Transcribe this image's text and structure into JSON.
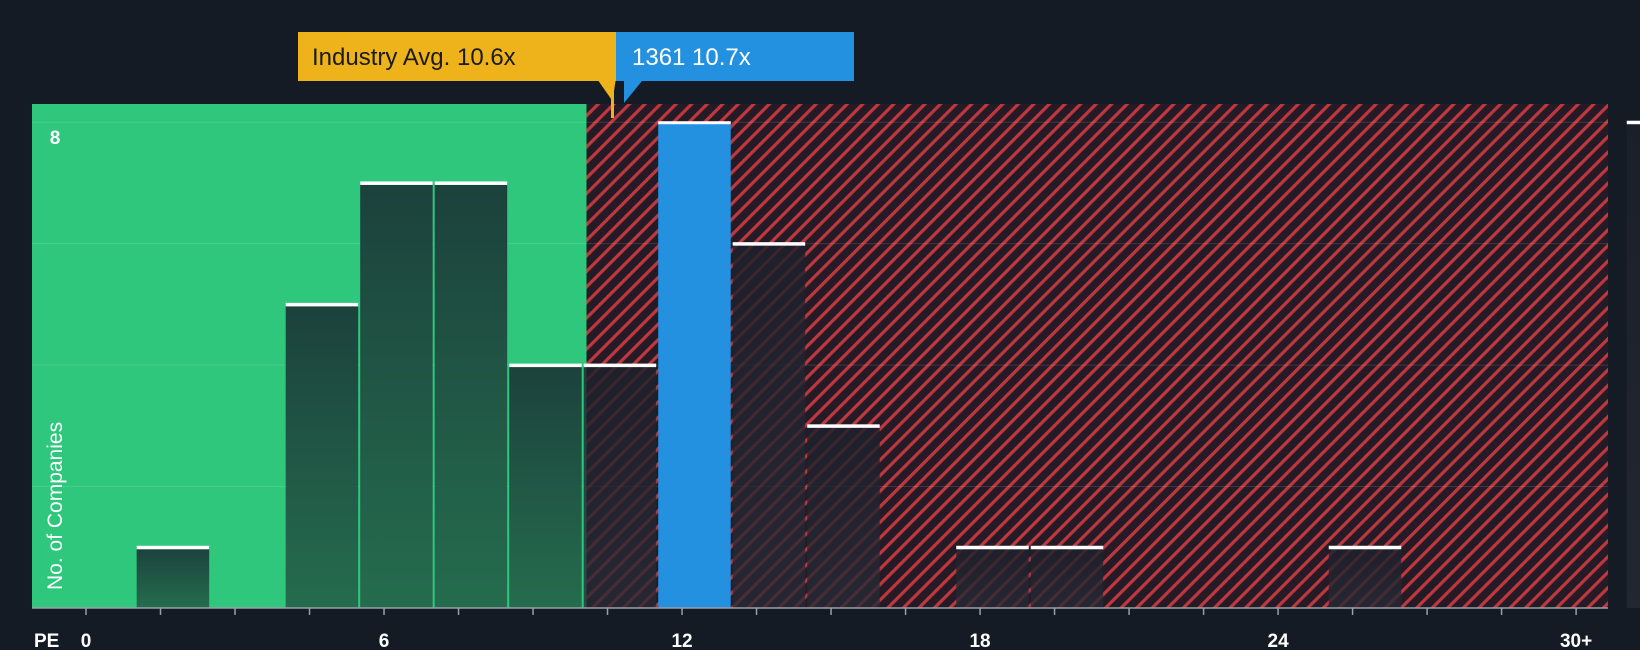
{
  "chart_data": {
    "type": "bar",
    "title": "",
    "xlabel": "PE",
    "ylabel": "No. of Companies",
    "x_ticks": [
      "0",
      "6",
      "12",
      "18",
      "24",
      "30+"
    ],
    "y_ticks": [
      "8"
    ],
    "ylim": [
      0,
      8.3
    ],
    "bins": [
      {
        "from": 1.0,
        "to": 2.5,
        "value": 1
      },
      {
        "from": 4.0,
        "to": 5.5,
        "value": 5
      },
      {
        "from": 5.5,
        "to": 7.0,
        "value": 7
      },
      {
        "from": 7.0,
        "to": 8.5,
        "value": 7
      },
      {
        "from": 8.5,
        "to": 10.0,
        "value": 4
      },
      {
        "from": 10.0,
        "to": 11.5,
        "value": 4
      },
      {
        "from": 11.5,
        "to": 13.0,
        "value": 8,
        "highlight": true
      },
      {
        "from": 13.0,
        "to": 14.5,
        "value": 6
      },
      {
        "from": 14.5,
        "to": 16.0,
        "value": 3
      },
      {
        "from": 17.5,
        "to": 19.0,
        "value": 1
      },
      {
        "from": 19.0,
        "to": 20.5,
        "value": 1
      },
      {
        "from": 25.0,
        "to": 26.5,
        "value": 1
      },
      {
        "from": 31.0,
        "to": 32.5,
        "value": 8
      }
    ],
    "industry_avg": {
      "label": "Industry Avg. 10.6x",
      "value": 10.6
    },
    "company": {
      "label": "1361 10.7x",
      "value": 10.7
    },
    "colors": {
      "background": "#151b24",
      "fair_zone": "#2ec77c",
      "expensive_stripe": "#c0383e",
      "highlight_bar": "#2391e0",
      "industry_callout": "#eeb31a",
      "company_callout": "#2391e0"
    }
  }
}
